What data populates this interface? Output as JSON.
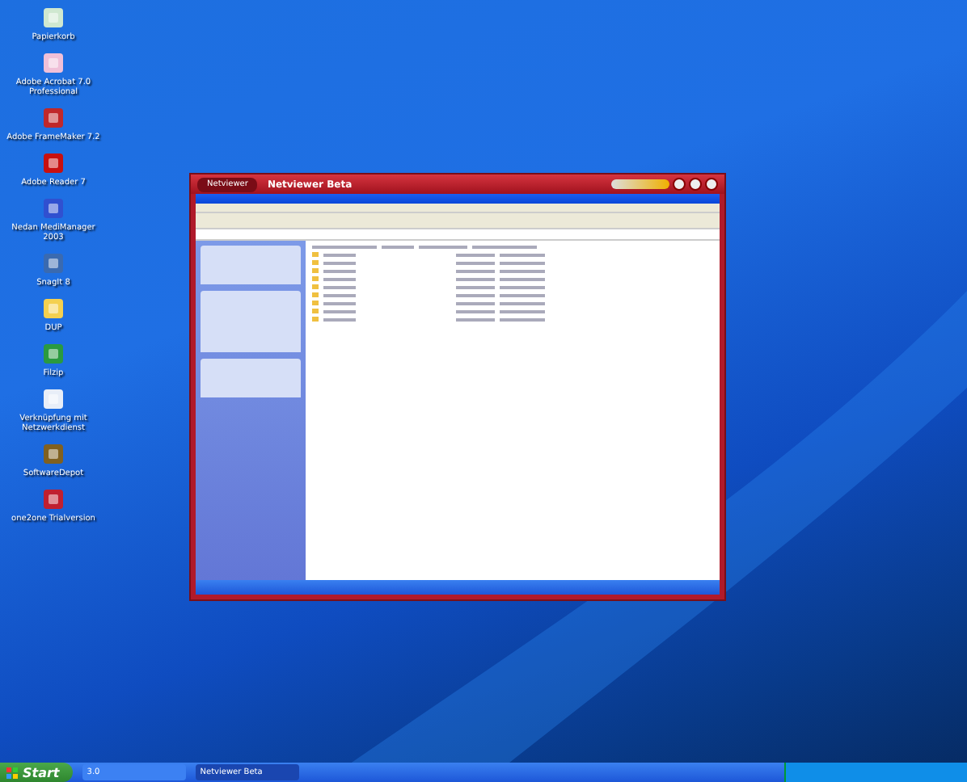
{
  "desktop_icons": [
    {
      "label": "Papierkorb",
      "kind": "bin"
    },
    {
      "label": "Adobe Acrobat 7.0 Professional",
      "kind": "acrobat"
    },
    {
      "label": "Adobe FrameMaker 7.2",
      "kind": "frame"
    },
    {
      "label": "Adobe Reader 7",
      "kind": "reader"
    },
    {
      "label": "Nedan MediManager 2003",
      "kind": "dots"
    },
    {
      "label": "SnagIt 8",
      "kind": "globe"
    },
    {
      "label": "DUP",
      "kind": "folder"
    },
    {
      "label": "Filzip",
      "kind": "zip"
    },
    {
      "label": "Verknüpfung mit Netzwerkdienst",
      "kind": "window"
    },
    {
      "label": "SoftwareDepot",
      "kind": "box"
    },
    {
      "label": "one2one Trialversion",
      "kind": "red"
    }
  ],
  "window": {
    "menu_label": "Netviewer",
    "title": "Netviewer Beta"
  },
  "taskbar": {
    "start": "Start",
    "items": [
      {
        "label": "3.0",
        "selected": false
      },
      {
        "label": "Netviewer Beta",
        "selected": true
      }
    ]
  }
}
